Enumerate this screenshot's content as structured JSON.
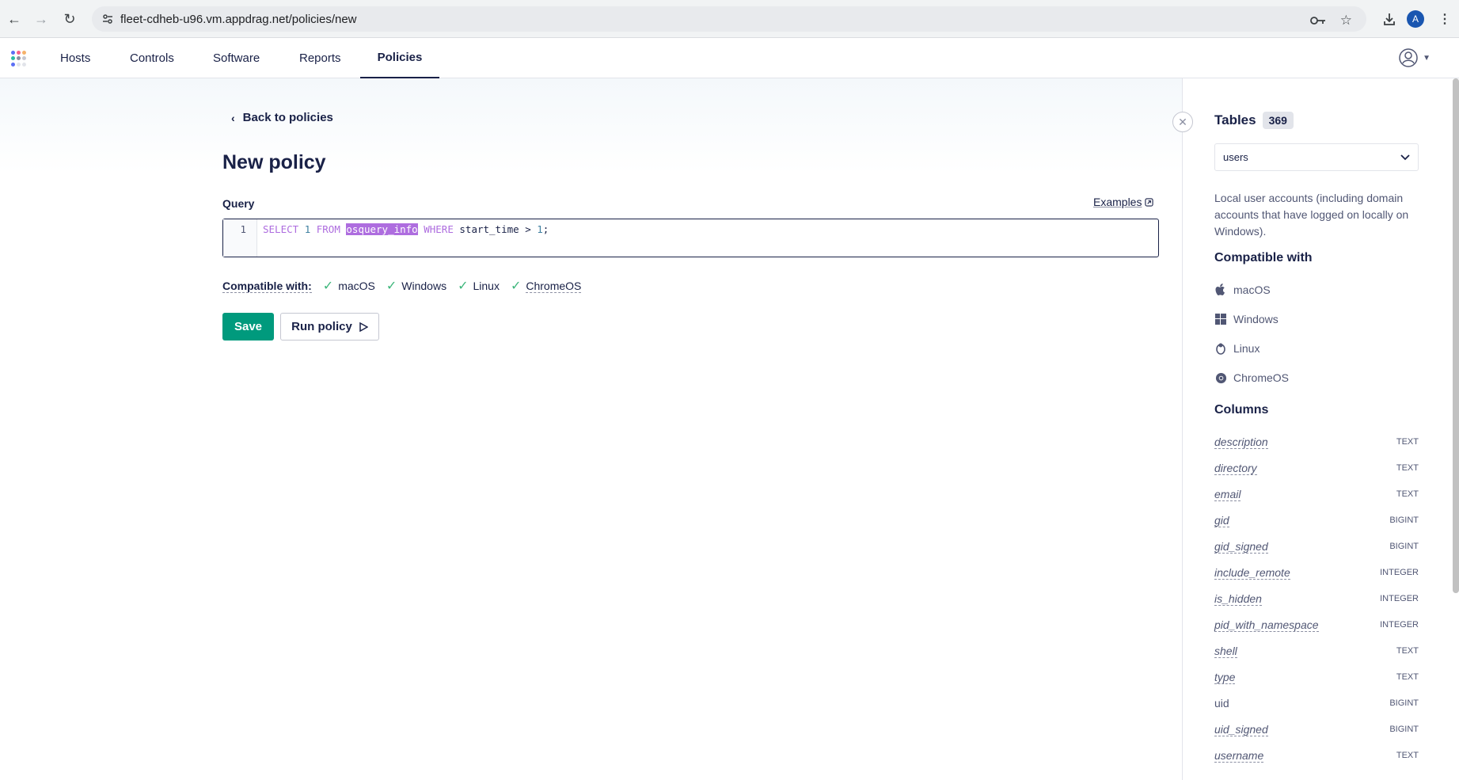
{
  "browser": {
    "url": "fleet-cdheb-u96.vm.appdrag.net/policies/new",
    "avatar_letter": "A"
  },
  "nav": {
    "items": [
      {
        "label": "Hosts"
      },
      {
        "label": "Controls"
      },
      {
        "label": "Software"
      },
      {
        "label": "Reports"
      },
      {
        "label": "Policies",
        "active": true
      }
    ]
  },
  "main": {
    "back_label": "Back to policies",
    "title": "New policy",
    "query_label": "Query",
    "examples_label": "Examples",
    "editor": {
      "line_number": "1",
      "tokens": {
        "select": "SELECT",
        "one": "1",
        "from": "FROM",
        "table": "osquery_info",
        "where": "WHERE",
        "rest": "start_time >",
        "num": "1",
        "end": ";"
      }
    },
    "compatible_label": "Compatible with:",
    "platforms": [
      "macOS",
      "Windows",
      "Linux",
      "ChromeOS"
    ],
    "save_label": "Save",
    "run_label": "Run policy"
  },
  "sidebar": {
    "tables_title": "Tables",
    "tables_count": "369",
    "selected_table": "users",
    "description": "Local user accounts (including domain accounts that have logged on locally on Windows).",
    "compatible_title": "Compatible with",
    "platforms": [
      {
        "label": "macOS",
        "icon": "apple-icon"
      },
      {
        "label": "Windows",
        "icon": "windows-icon"
      },
      {
        "label": "Linux",
        "icon": "linux-icon"
      },
      {
        "label": "ChromeOS",
        "icon": "chrome-icon"
      }
    ],
    "columns_title": "Columns",
    "columns": [
      {
        "name": "description",
        "type": "TEXT"
      },
      {
        "name": "directory",
        "type": "TEXT"
      },
      {
        "name": "email",
        "type": "TEXT"
      },
      {
        "name": "gid",
        "type": "BIGINT"
      },
      {
        "name": "gid_signed",
        "type": "BIGINT"
      },
      {
        "name": "include_remote",
        "type": "INTEGER"
      },
      {
        "name": "is_hidden",
        "type": "INTEGER"
      },
      {
        "name": "pid_with_namespace",
        "type": "INTEGER"
      },
      {
        "name": "shell",
        "type": "TEXT"
      },
      {
        "name": "type",
        "type": "TEXT"
      },
      {
        "name": "uid",
        "type": "BIGINT"
      },
      {
        "name": "uid_signed",
        "type": "BIGINT"
      },
      {
        "name": "username",
        "type": "TEXT"
      }
    ]
  },
  "colors": {
    "primary_text": "#192147",
    "accent_green": "#009a7d",
    "check_green": "#3db67b",
    "sql_keyword": "#ae6ddf"
  }
}
